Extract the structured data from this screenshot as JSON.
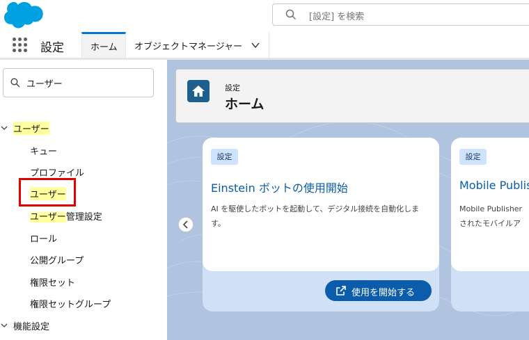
{
  "header": {
    "search_placeholder": "[設定] を検索"
  },
  "context_bar": {
    "app_name": "設定",
    "tabs": [
      {
        "label": "ホーム"
      },
      {
        "label": "オブジェクトマネージャー"
      }
    ]
  },
  "sidebar": {
    "search_value": "ユーザー",
    "tree": [
      {
        "label": "ユーザー"
      },
      {
        "label": "キュー"
      },
      {
        "label": "プロファイル"
      },
      {
        "label": "ユーザー"
      },
      {
        "label_highlight": "ユーザー",
        "label_rest": "管理設定"
      },
      {
        "label": "ロール"
      },
      {
        "label": "公開グループ"
      },
      {
        "label": "権限セット"
      },
      {
        "label": "権限セットグループ"
      },
      {
        "label": "機能設定"
      }
    ]
  },
  "page_header": {
    "kicker": "設定",
    "title": "ホーム"
  },
  "cards": [
    {
      "badge": "設定",
      "title": "Einstein ボットの使用開始",
      "desc": "AI を駆使したボットを起動して、デジタル接続を自動化します。",
      "cta": "使用を開始する"
    },
    {
      "badge": "設定",
      "title": "Mobile Publis",
      "desc": "Mobile Publisherされたモバイルア"
    }
  ],
  "colors": {
    "brand_blue": "#0b5cab",
    "salesforce_cloud": "#00a1e0",
    "highlight": "#ffff9e",
    "annotation_red": "#e00000",
    "main_bg": "#b0c4df"
  }
}
